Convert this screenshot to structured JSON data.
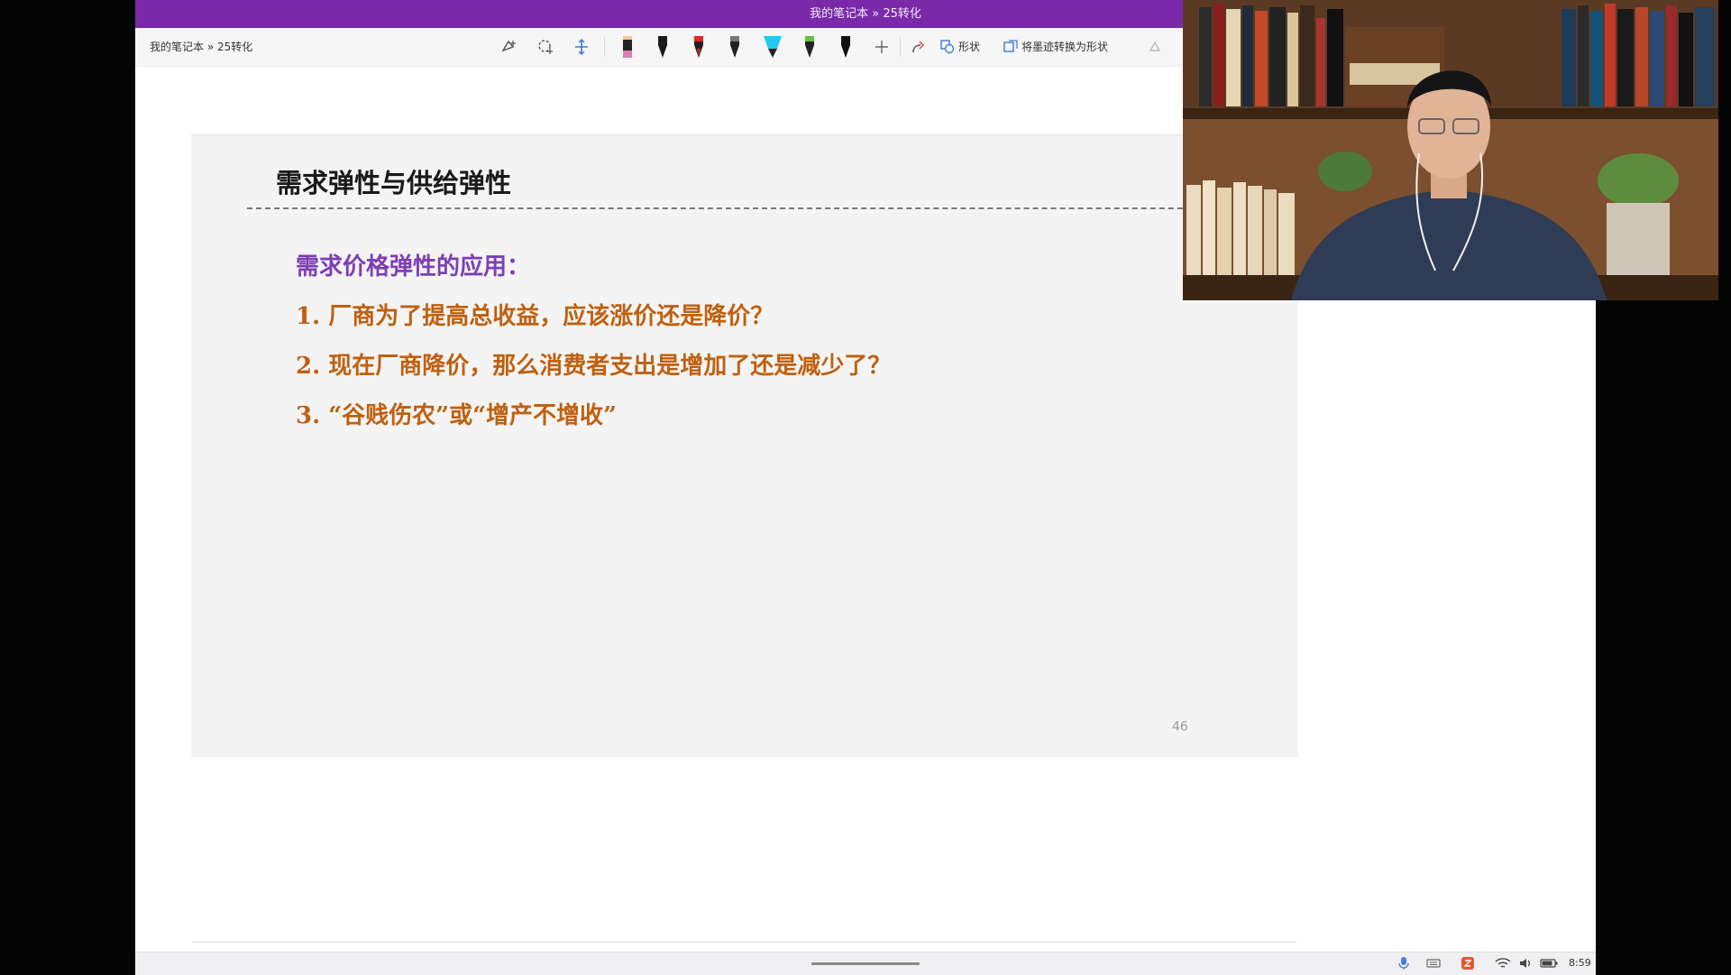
{
  "window": {
    "title": "我的笔记本 » 25转化"
  },
  "toolbar": {
    "breadcrumb": "我的笔记本 » 25转化",
    "shapes_label": "形状",
    "convert_label": "将墨迹转换为形状",
    "pens": [
      {
        "name": "pink-highlighter",
        "color": "#d87fb4"
      },
      {
        "name": "black-pen",
        "color": "#1a1a1a"
      },
      {
        "name": "red-pen",
        "color": "#e02424"
      },
      {
        "name": "gray-pen",
        "color": "#777777"
      },
      {
        "name": "cyan-highlighter",
        "color": "#22c8ee"
      },
      {
        "name": "green-highlighter",
        "color": "#6ac23a"
      },
      {
        "name": "black-pen-2",
        "color": "#111111"
      }
    ]
  },
  "slide": {
    "title": "需求弹性与供给弹性",
    "subtitle": "需求价格弹性的应用：",
    "items": [
      "1. 厂商为了提高总收益，应该涨价还是降价？",
      "2. 现在厂商降价，那么消费者支出是增加了还是减少了？",
      "3. “谷贱伤农”或“增产不增收”"
    ],
    "page_number": "46"
  },
  "taskbar": {
    "clock": "8:59"
  },
  "colors": {
    "titlebar": "#7a2aa8",
    "subtitle": "#7e3eb5",
    "items": "#c0600f"
  }
}
